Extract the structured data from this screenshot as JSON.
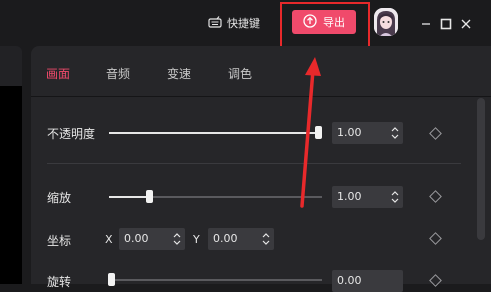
{
  "titlebar": {
    "shortcut_label": "快捷键",
    "export_label": "导出"
  },
  "tabs": [
    {
      "label": "画面",
      "active": true
    },
    {
      "label": "音频",
      "active": false
    },
    {
      "label": "变速",
      "active": false
    },
    {
      "label": "调色",
      "active": false
    }
  ],
  "properties": {
    "opacity": {
      "label": "不透明度",
      "value": "1.00",
      "level": 1.0
    },
    "scale": {
      "label": "缩放",
      "value": "1.00",
      "level": 0.19
    },
    "position": {
      "label": "坐标",
      "x_label": "X",
      "x_value": "0.00",
      "y_label": "Y",
      "y_value": "0.00"
    },
    "rotation": {
      "label": "旋转",
      "value": "0.00",
      "level": 0.0
    }
  },
  "colors": {
    "accent": "#f04a6b",
    "annotation": "#e8292b",
    "panel": "#262629",
    "background": "#1b1b1d"
  }
}
